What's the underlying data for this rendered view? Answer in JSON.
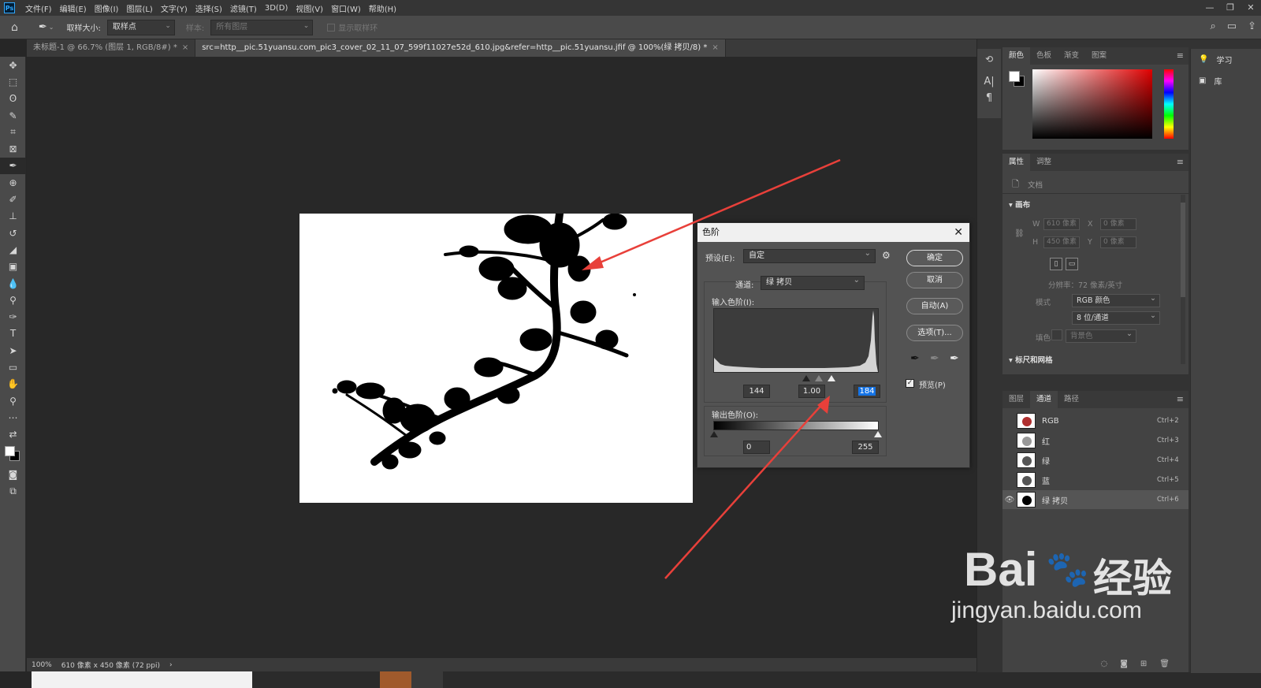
{
  "menu": [
    "文件(F)",
    "编辑(E)",
    "图像(I)",
    "图层(L)",
    "文字(Y)",
    "选择(S)",
    "滤镜(T)",
    "3D(D)",
    "视图(V)",
    "窗口(W)",
    "帮助(H)"
  ],
  "app_logo": "Ps",
  "options": {
    "sample_size_label": "取样大小:",
    "sample_size_value": "取样点",
    "sample_label": "样本:",
    "sample_value": "所有图层",
    "show_ring_label": "显示取样环"
  },
  "tabs": [
    {
      "label": "未标题-1 @ 66.7% (图层 1, RGB/8#) *",
      "close": "×"
    },
    {
      "label": "src=http__pic.51yuansu.com_pic3_cover_02_11_07_599f11027e52d_610.jpg&refer=http__pic.51yuansu.jfif @ 100%(绿 拷贝/8) *",
      "close": "×"
    }
  ],
  "status": {
    "zoom": "100%",
    "doc_info": "610 像素 x 450 像素 (72 ppi)",
    "arrow": "›"
  },
  "dialog": {
    "title": "色阶",
    "close": "✕",
    "preset_label": "预设(E):",
    "preset_value": "自定",
    "channel_label": "通道:",
    "channel_value": "绿 拷贝",
    "input_label": "输入色阶(I):",
    "input_black": "144",
    "input_mid": "1.00",
    "input_white": "184",
    "output_label": "输出色阶(O):",
    "output_black": "0",
    "output_white": "255",
    "ok": "确定",
    "cancel": "取消",
    "auto": "自动(A)",
    "options": "选项(T)...",
    "preview": "预览(P)"
  },
  "color_panel": {
    "tabs": [
      "颜色",
      "色板",
      "渐变",
      "图案"
    ]
  },
  "properties_panel": {
    "tabs": [
      "属性",
      "调整"
    ],
    "doc_label": "文档",
    "canvas_label": "画布",
    "w_label": "W",
    "w_value": "610 像素",
    "h_label": "H",
    "h_value": "450 像素",
    "x_label": "X",
    "x_value": "0 像素",
    "y_label": "Y",
    "y_value": "0 像素",
    "resolution": "分辨率：72 像素/英寸",
    "mode_label": "模式",
    "mode_value": "RGB 颜色",
    "depth_value": "8 位/通道",
    "fill_label": "填色",
    "fill_value": "背景色",
    "rulers_label": "标尺和网格"
  },
  "channels_panel": {
    "tabs": [
      "图层",
      "通道",
      "路径"
    ],
    "rows": [
      {
        "name": "RGB",
        "shortcut": "Ctrl+2"
      },
      {
        "name": "红",
        "shortcut": "Ctrl+3"
      },
      {
        "name": "绿",
        "shortcut": "Ctrl+4"
      },
      {
        "name": "蓝",
        "shortcut": "Ctrl+5"
      },
      {
        "name": "绿 拷贝",
        "shortcut": "Ctrl+6"
      }
    ]
  },
  "right_dock": {
    "learn": "学习",
    "library": "库"
  },
  "watermark": {
    "brand": "Bai",
    "brand2": "经验",
    "url": "jingyan.baidu.com"
  },
  "colors": {
    "accent": "#1473e6",
    "arrow": "#e8403a",
    "panel": "#434343",
    "canvas": "#282828"
  }
}
